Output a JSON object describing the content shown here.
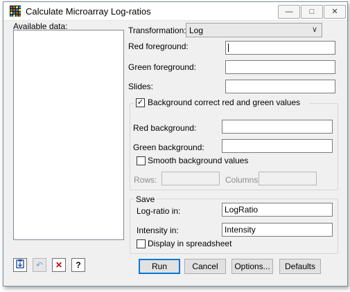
{
  "window": {
    "title": "Calculate Microarray Log-ratios"
  },
  "caption_buttons": {
    "minimize": "—",
    "maximize": "□",
    "close": "✕"
  },
  "available_data": {
    "label": "Available data:"
  },
  "transformation": {
    "label": "Transformation:",
    "value": "Log",
    "chevron": "∨"
  },
  "red_foreground": {
    "label": "Red foreground:",
    "value": ""
  },
  "green_foreground": {
    "label": "Green foreground:",
    "value": ""
  },
  "slides": {
    "label": "Slides:",
    "value": ""
  },
  "background": {
    "checkbox_label": "Background correct red and green values",
    "checked": true,
    "check_mark": "✓",
    "red_label": "Red background:",
    "red_value": "",
    "green_label": "Green background:",
    "green_value": "",
    "smooth_label": "Smooth background values",
    "rows_label": "Rows:",
    "columns_label": "Columns:"
  },
  "save": {
    "legend": "Save",
    "logratio_label": "Log-ratio in:",
    "logratio_value": "LogRatio",
    "intensity_label": "Intensity in:",
    "intensity_value": "Intensity",
    "spreadsheet_label": "Display in spreadsheet"
  },
  "buttons": {
    "run": "Run",
    "cancel": "Cancel",
    "options": "Options...",
    "defaults": "Defaults"
  },
  "toolbar": {
    "help_glyph": "?",
    "delete_glyph": "✕",
    "undo_glyph": "↶"
  },
  "colors": {
    "accent": "#0078d7",
    "delete_red": "#c00000"
  }
}
